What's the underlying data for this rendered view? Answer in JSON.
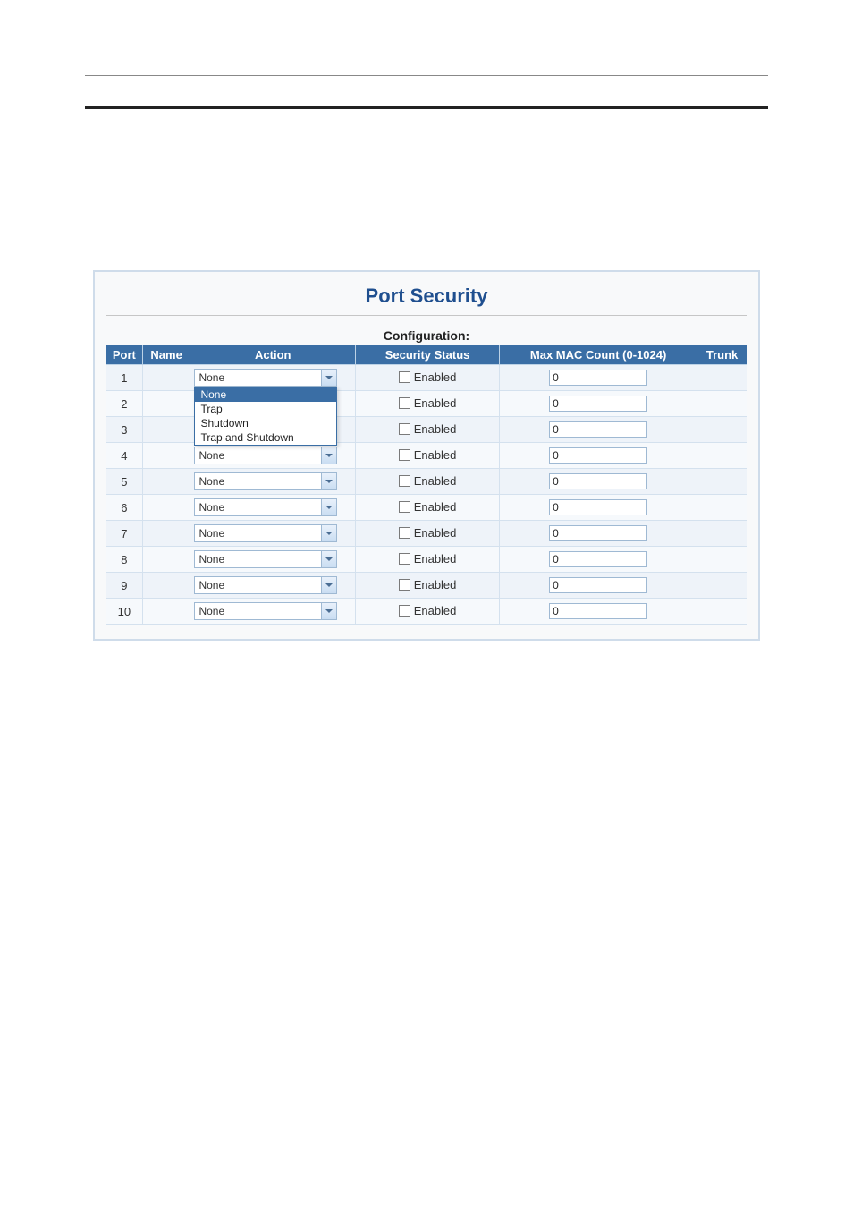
{
  "page": {
    "title": "Port Security",
    "section_label": "Configuration:"
  },
  "columns": {
    "port": "Port",
    "name": "Name",
    "action": "Action",
    "security_status": "Security Status",
    "max_mac": "Max MAC Count (0-1024)",
    "trunk": "Trunk"
  },
  "action_options": [
    "None",
    "Trap",
    "Shutdown",
    "Trap and Shutdown"
  ],
  "status_checkbox_label": "Enabled",
  "rows": [
    {
      "port": "1",
      "name": "",
      "action": "None",
      "dropdown_open": true,
      "enabled": false,
      "max_mac": "0",
      "trunk": ""
    },
    {
      "port": "2",
      "name": "",
      "action": "None",
      "dropdown_open": false,
      "enabled": false,
      "max_mac": "0",
      "trunk": ""
    },
    {
      "port": "3",
      "name": "",
      "action": "None",
      "dropdown_open": false,
      "enabled": false,
      "max_mac": "0",
      "trunk": ""
    },
    {
      "port": "4",
      "name": "",
      "action": "None",
      "dropdown_open": false,
      "enabled": false,
      "max_mac": "0",
      "trunk": ""
    },
    {
      "port": "5",
      "name": "",
      "action": "None",
      "dropdown_open": false,
      "enabled": false,
      "max_mac": "0",
      "trunk": ""
    },
    {
      "port": "6",
      "name": "",
      "action": "None",
      "dropdown_open": false,
      "enabled": false,
      "max_mac": "0",
      "trunk": ""
    },
    {
      "port": "7",
      "name": "",
      "action": "None",
      "dropdown_open": false,
      "enabled": false,
      "max_mac": "0",
      "trunk": ""
    },
    {
      "port": "8",
      "name": "",
      "action": "None",
      "dropdown_open": false,
      "enabled": false,
      "max_mac": "0",
      "trunk": ""
    },
    {
      "port": "9",
      "name": "",
      "action": "None",
      "dropdown_open": false,
      "enabled": false,
      "max_mac": "0",
      "trunk": ""
    },
    {
      "port": "10",
      "name": "",
      "action": "None",
      "dropdown_open": false,
      "enabled": false,
      "max_mac": "0",
      "trunk": ""
    }
  ]
}
